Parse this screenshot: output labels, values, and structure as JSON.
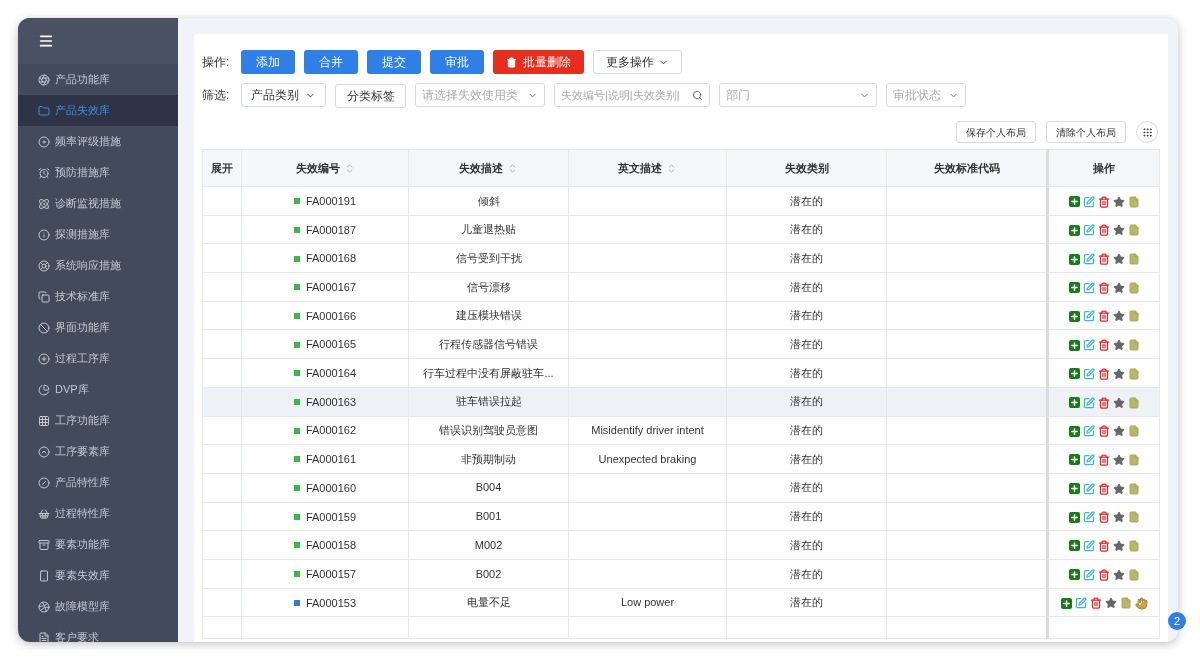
{
  "sidebar": {
    "items": [
      {
        "label": "产品功能库",
        "selected": false
      },
      {
        "label": "产品失效库",
        "selected": true
      },
      {
        "label": "频率评级措施",
        "selected": false
      },
      {
        "label": "预防措施库",
        "selected": false
      },
      {
        "label": "诊断监视措施",
        "selected": false
      },
      {
        "label": "探测措施库",
        "selected": false
      },
      {
        "label": "系统响应措施",
        "selected": false
      },
      {
        "label": "技术标准库",
        "selected": false
      },
      {
        "label": "界面功能库",
        "selected": false
      },
      {
        "label": "过程工序库",
        "selected": false
      },
      {
        "label": "DVP库",
        "selected": false
      },
      {
        "label": "工序功能库",
        "selected": false
      },
      {
        "label": "工序要素库",
        "selected": false
      },
      {
        "label": "产品特性库",
        "selected": false
      },
      {
        "label": "过程特性库",
        "selected": false
      },
      {
        "label": "要素功能库",
        "selected": false
      },
      {
        "label": "要素失效库",
        "selected": false
      },
      {
        "label": "故障模型库",
        "selected": false
      },
      {
        "label": "客户要求",
        "selected": false
      }
    ]
  },
  "toolbar": {
    "label": "操作:",
    "buttons": [
      {
        "label": "添加",
        "kind": "primary"
      },
      {
        "label": "合并",
        "kind": "primary"
      },
      {
        "label": "提交",
        "kind": "primary"
      },
      {
        "label": "审批",
        "kind": "primary"
      },
      {
        "label": "批量删除",
        "kind": "danger"
      },
      {
        "label": "更多操作",
        "kind": "dropdown"
      }
    ]
  },
  "filters": {
    "label": "筛选:",
    "items": [
      {
        "kind": "dropdown",
        "value": "产品类别"
      },
      {
        "kind": "button",
        "value": "分类标签"
      },
      {
        "kind": "select",
        "placeholder": "请选择失效使用类"
      },
      {
        "kind": "search",
        "placeholder": "失效编号|说明|失效类别|"
      },
      {
        "kind": "select",
        "placeholder": "部门"
      },
      {
        "kind": "select",
        "placeholder": "审批状态"
      }
    ]
  },
  "layout_buttons": [
    "保存个人布局",
    "清除个人布局"
  ],
  "table": {
    "columns": [
      {
        "label": "展开",
        "sortable": false
      },
      {
        "label": "失效编号",
        "sortable": true
      },
      {
        "label": "失效描述",
        "sortable": true
      },
      {
        "label": "英文描述",
        "sortable": true
      },
      {
        "label": "失效类别",
        "sortable": false
      },
      {
        "label": "失效标准代码",
        "sortable": false
      },
      {
        "label": "操作",
        "sortable": false
      }
    ],
    "rows": [
      {
        "code": "FA000191",
        "color": "#3cb84a",
        "description": "倾斜",
        "english": "",
        "category": "潜在的",
        "selected": false,
        "hand_action": false
      },
      {
        "code": "FA000187",
        "color": "#3cb84a",
        "description": "儿童退热贴",
        "english": "",
        "category": "潜在的",
        "selected": false,
        "hand_action": false
      },
      {
        "code": "FA000168",
        "color": "#3cb84a",
        "description": "信号受到干扰",
        "english": "",
        "category": "潜在的",
        "selected": false,
        "hand_action": false
      },
      {
        "code": "FA000167",
        "color": "#3cb84a",
        "description": "信号漂移",
        "english": "",
        "category": "潜在的",
        "selected": false,
        "hand_action": false
      },
      {
        "code": "FA000166",
        "color": "#3cb84a",
        "description": "建压模块错误",
        "english": "",
        "category": "潜在的",
        "selected": false,
        "hand_action": false
      },
      {
        "code": "FA000165",
        "color": "#3cb84a",
        "description": "行程传感器信号错误",
        "english": "",
        "category": "潜在的",
        "selected": false,
        "hand_action": false
      },
      {
        "code": "FA000164",
        "color": "#3cb84a",
        "description": "行车过程中没有屏蔽驻车...",
        "english": "",
        "category": "潜在的",
        "selected": false,
        "hand_action": false
      },
      {
        "code": "FA000163",
        "color": "#3cb84a",
        "description": "驻车错误拉起",
        "english": "",
        "category": "潜在的",
        "selected": true,
        "hand_action": false
      },
      {
        "code": "FA000162",
        "color": "#3cb84a",
        "description": "错误识别驾驶员意图",
        "english": "Misidentify driver intent",
        "category": "潜在的",
        "selected": false,
        "hand_action": false
      },
      {
        "code": "FA000161",
        "color": "#3cb84a",
        "description": "非预期制动",
        "english": "Unexpected braking",
        "category": "潜在的",
        "selected": false,
        "hand_action": false
      },
      {
        "code": "FA000160",
        "color": "#3cb84a",
        "description": "B004",
        "english": "",
        "category": "潜在的",
        "selected": false,
        "hand_action": false
      },
      {
        "code": "FA000159",
        "color": "#3cb84a",
        "description": "B001",
        "english": "",
        "category": "潜在的",
        "selected": false,
        "hand_action": false
      },
      {
        "code": "FA000158",
        "color": "#3cb84a",
        "description": "M002",
        "english": "",
        "category": "潜在的",
        "selected": false,
        "hand_action": false
      },
      {
        "code": "FA000157",
        "color": "#3cb84a",
        "description": "B002",
        "english": "",
        "category": "潜在的",
        "selected": false,
        "hand_action": false
      },
      {
        "code": "FA000153",
        "color": "#3a7bd5",
        "description": "电量不足",
        "english": "Low power",
        "category": "潜在的",
        "selected": false,
        "hand_action": true
      }
    ]
  },
  "notification_badge": "2"
}
